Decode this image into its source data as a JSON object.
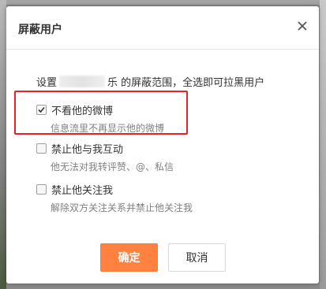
{
  "dialog": {
    "title": "屏蔽用户",
    "close_icon": "close-icon",
    "description_prefix": "设置",
    "description_name_suffix": "乐",
    "description_suffix": " 的屏蔽范围，全选即可拉黑用户"
  },
  "options": [
    {
      "label": "不看他的微博",
      "sub": "信息流里不再显示他的微博",
      "checked": true
    },
    {
      "label": "禁止他与我互动",
      "sub": "他无法对我转评赞、@、私信",
      "checked": false
    },
    {
      "label": "禁止他关注我",
      "sub": "解除双方关注关系并禁止他关注我",
      "checked": false
    }
  ],
  "buttons": {
    "confirm": "确定",
    "cancel": "取消"
  },
  "colors": {
    "confirm_bg": "#ff8140",
    "highlight": "#e8202a"
  }
}
